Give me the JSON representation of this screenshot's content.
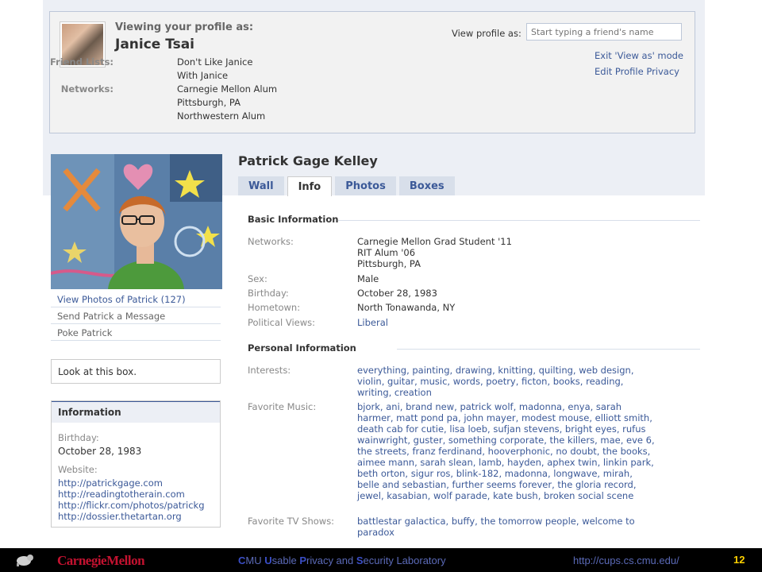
{
  "view_as": {
    "heading": "Viewing your profile as:",
    "viewer_name": "Janice Tsai",
    "friend_lists_label": "Friend Lists:",
    "friend_lists": [
      "Don't Like Janice",
      "With Janice"
    ],
    "networks_label": "Networks:",
    "networks": [
      "Carnegie Mellon Alum",
      "Pittsburgh, PA",
      "Northwestern Alum"
    ],
    "input_label": "View profile as:",
    "input_placeholder": "Start typing a friend's name",
    "exit_link": "Exit 'View as' mode",
    "edit_privacy_link": "Edit Profile Privacy"
  },
  "left_column": {
    "links": [
      "View Photos of Patrick (127)",
      "Send Patrick a Message",
      "Poke Patrick"
    ],
    "look_box_text": "Look at this box.",
    "info_box": {
      "title": "Information",
      "birthday_label": "Birthday:",
      "birthday": "October 28, 1983",
      "website_label": "Website:",
      "websites": [
        "http://patrickgage.com",
        "http://readingtotherain.com",
        "http://flickr.com/photos/patrickg",
        "http://dossier.thetartan.org"
      ]
    }
  },
  "profile": {
    "name": "Patrick Gage Kelley",
    "tabs": [
      "Wall",
      "Info",
      "Photos",
      "Boxes"
    ],
    "active_tab": "Info",
    "basic_title": "Basic Information",
    "basic": {
      "networks_label": "Networks:",
      "networks": [
        "Carnegie Mellon Grad Student '11",
        "RIT Alum '06",
        "Pittsburgh, PA"
      ],
      "sex_label": "Sex:",
      "sex": "Male",
      "birthday_label": "Birthday:",
      "birthday": "October 28, 1983",
      "hometown_label": "Hometown:",
      "hometown": "North Tonawanda, NY",
      "political_label": "Political Views:",
      "political": "Liberal"
    },
    "personal_title": "Personal Information",
    "personal": {
      "interests_label": "Interests:",
      "interests": "everything, painting, drawing, knitting, quilting, web design, violin, guitar, music, words, poetry, ficton, books, reading, writing, creation",
      "music_label": "Favorite Music:",
      "music": "bjork, ani, brand new, patrick wolf, madonna, enya, sarah harmer, matt pond pa, john mayer, modest mouse, elliott smith, death cab for cutie, lisa loeb, sufjan stevens, bright eyes, rufus wainwright, guster, something corporate, the killers, mae, eve 6, the streets, franz ferdinand, hooverphonic, no doubt, the books, aimee mann, sarah slean, lamb, hayden, aphex twin, linkin park, beth orton, sigur ros, blink-182, madonna, longwave, mirah, belle and sebastian, further seems forever, the gloria record, jewel, kasabian, wolf parade, kate bush, broken social scene",
      "tv_label": "Favorite TV Shows:",
      "tv": "battlestar galactica, buffy, the tomorrow people, welcome to paradox"
    }
  },
  "footer": {
    "brand": "CarnegieMellon",
    "lab_initial_1": "C",
    "lab_rest_1": "MU ",
    "lab_initial_2": "U",
    "lab_rest_2": "sable ",
    "lab_initial_3": "P",
    "lab_rest_3": "rivacy and ",
    "lab_initial_4": "S",
    "lab_rest_4": "ecurity Laboratory",
    "url": "http://cups.cs.cmu.edu/",
    "page_number": "12"
  },
  "colors": {
    "link": "#3b5998",
    "footer_brand": "#c41230",
    "page_number": "#ffd200"
  }
}
